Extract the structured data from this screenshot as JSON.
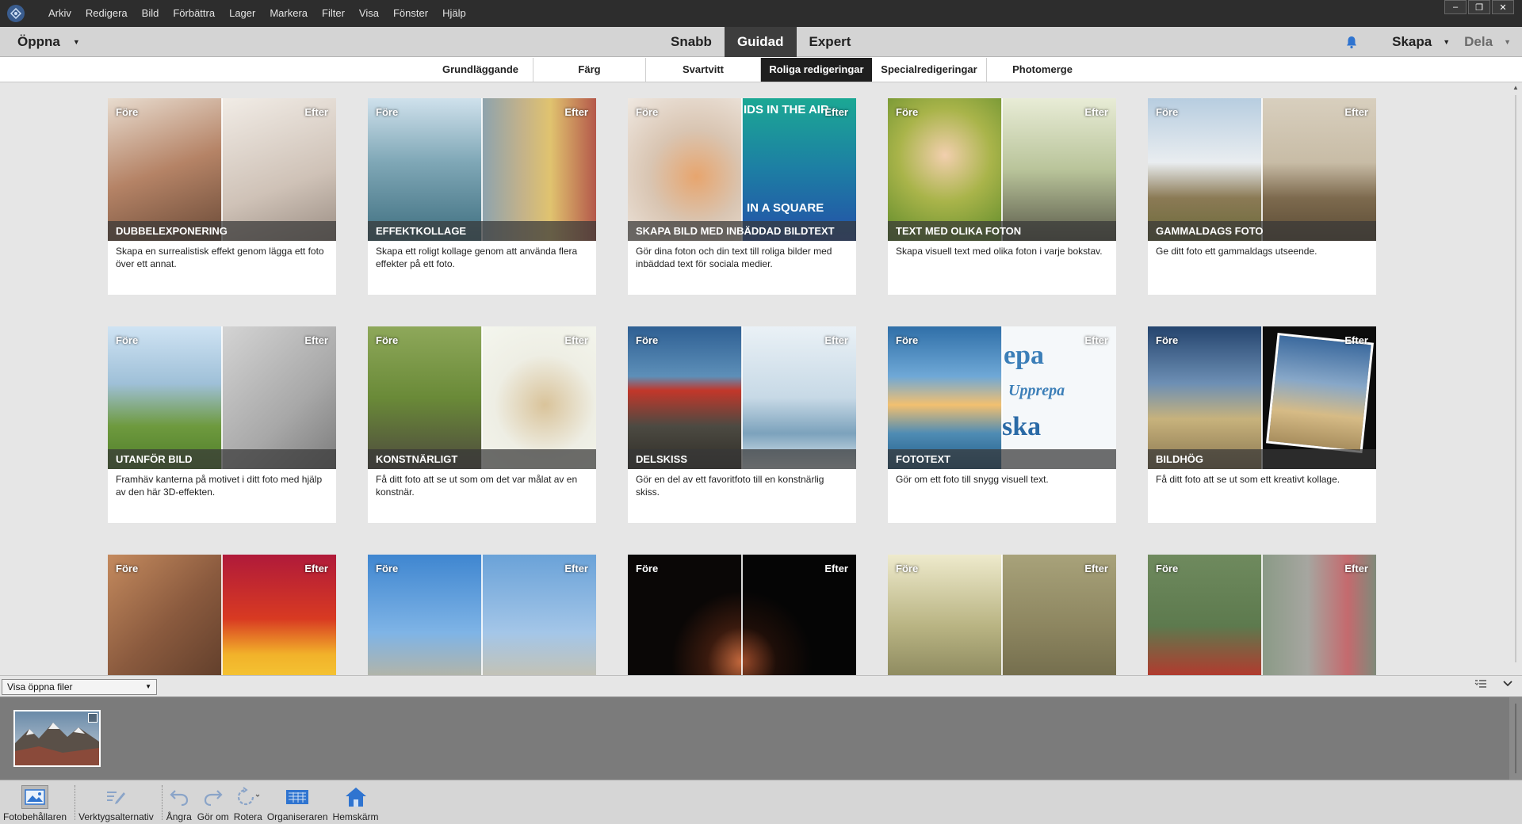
{
  "menubar": {
    "items": [
      "Arkiv",
      "Redigera",
      "Bild",
      "Förbättra",
      "Lager",
      "Markera",
      "Filter",
      "Visa",
      "Fönster",
      "Hjälp"
    ],
    "window_controls": [
      "–",
      "❐",
      "✕"
    ]
  },
  "modebar": {
    "open_label": "Öppna",
    "tabs": [
      {
        "label": "Snabb",
        "active": false
      },
      {
        "label": "Guidad",
        "active": true
      },
      {
        "label": "Expert",
        "active": false
      }
    ],
    "create_label": "Skapa",
    "share_label": "Dela"
  },
  "categories": [
    {
      "label": "Grundläggande",
      "active": false
    },
    {
      "label": "Färg",
      "active": false
    },
    {
      "label": "Svartvitt",
      "active": false
    },
    {
      "label": "Roliga redigeringar",
      "active": true
    },
    {
      "label": "Specialredigeringar",
      "active": false
    },
    {
      "label": "Photomerge",
      "active": false
    }
  ],
  "card_labels": {
    "before": "Före",
    "after": "Efter"
  },
  "cards": [
    {
      "title": "DUBBELEXPONERING",
      "desc": "Skapa en surrealistisk effekt genom lägga ett foto över ett annat.",
      "left_color": "#c9a48c",
      "right_color": "#e8e2dc"
    },
    {
      "title": "EFFEKTKOLLAGE",
      "desc": "Skapa ett roligt kollage genom att använda flera effekter på ett foto.",
      "left_color": "#6e98a6",
      "right_color": "#b79a6a"
    },
    {
      "title": "SKAPA BILD MED INBÄDDAD BILDTEXT",
      "desc": "Gör dina foton och din text till roliga bilder med inbäddad text för sociala medier.",
      "left_color": "#d8c7b4",
      "right_color": "#1d9c8c",
      "overlay_top": "IDS IN THE AIR",
      "overlay_bottom": "IN A SQUARE"
    },
    {
      "title": "TEXT MED OLIKA FOTON",
      "desc": "Skapa visuell text med olika foton i varje bokstav.",
      "left_color": "#8aa23c",
      "right_color": "#cfd8b2"
    },
    {
      "title": "GAMMALDAGS FOTO",
      "desc": "Ge ditt foto ett gammaldags utseende.",
      "left_color": "#8ea7bd",
      "right_color": "#a89478"
    },
    {
      "title": "UTANFÖR BILD",
      "desc": "Framhäv kanterna på motivet i ditt foto med hjälp av den här 3D-effekten.",
      "left_color": "#7da64c",
      "right_color": "#9c9c9c"
    },
    {
      "title": "KONSTNÄRLIGT",
      "desc": "Få ditt foto att se ut som om det var målat av en konstnär.",
      "left_color": "#5e7d3a",
      "right_color": "#e8eadf"
    },
    {
      "title": "DELSKISS",
      "desc": "Gör en del av ett favoritfoto till en konstnärlig skiss.",
      "left_color": "#3c6c96",
      "right_color": "#cfdde6"
    },
    {
      "title": "FOTOTEXT",
      "desc": "Gör om ett foto till snygg visuell text.",
      "left_color": "#3f7fb0",
      "right_color": "#f3f6f8",
      "overlay_top": "epa",
      "overlay_mid": "Upprepa",
      "overlay_bottom": "ska"
    },
    {
      "title": "BILDHÖG",
      "desc": "Få ditt foto att se ut som ett kreativt kollage.",
      "left_color": "#3d5f8a",
      "right_color": "#d0b48a"
    },
    {
      "title": "",
      "desc": "",
      "left_color": "#8a5a3e",
      "right_color": "#d83a22"
    },
    {
      "title": "",
      "desc": "",
      "left_color": "#5a9ad6",
      "right_color": "#8fb7df"
    },
    {
      "title": "",
      "desc": "",
      "left_color": "#120d0a",
      "right_color": "#0a0a0a"
    },
    {
      "title": "",
      "desc": "",
      "left_color": "#b9b483",
      "right_color": "#8d8660"
    },
    {
      "title": "",
      "desc": "",
      "left_color": "#5d7a4e",
      "right_color": "#7f8a7a"
    }
  ],
  "bin": {
    "select_label": "Visa öppna filer"
  },
  "taskbar": [
    {
      "label": "Fotobehållaren",
      "icon": "photo-bin-icon"
    },
    {
      "label": "Verktygsalternativ",
      "icon": "tool-options-icon"
    },
    {
      "label": "Ångra",
      "icon": "undo-icon"
    },
    {
      "label": "Gör om",
      "icon": "redo-icon"
    },
    {
      "label": "Rotera",
      "icon": "rotate-icon"
    },
    {
      "label": "Organiseraren",
      "icon": "organizer-icon"
    },
    {
      "label": "Hemskärm",
      "icon": "home-icon"
    }
  ],
  "colors": {
    "accent_blue": "#2f74d0",
    "active_tab_bg": "#3d3d3d",
    "menubar_bg": "#2d2d2d"
  }
}
